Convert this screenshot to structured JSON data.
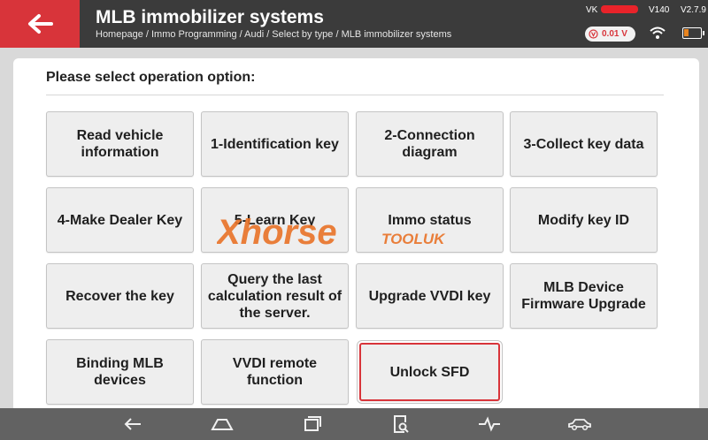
{
  "header": {
    "title": "MLB immobilizer systems",
    "breadcrumb": "Homepage / Immo Programming / Audi / Select by type / MLB immobilizer systems",
    "serial_prefix": "VK",
    "model": "V140",
    "version": "V2.7.9",
    "voltage": "0.01 V"
  },
  "main": {
    "prompt": "Please select operation option:",
    "options": [
      "Read vehicle information",
      "1-Identification key",
      "2-Connection diagram",
      "3-Collect key data",
      "4-Make Dealer Key",
      "5-Learn Key",
      "Immo status",
      "Modify key ID",
      "Recover the key",
      "Query the last calculation result of the server.",
      "Upgrade VVDI key",
      "MLB Device Firmware Upgrade",
      "Binding MLB devices",
      "VVDI remote function",
      "Unlock SFD"
    ],
    "selected_option": "Unlock SFD"
  },
  "watermark": {
    "brand": "Xhorse",
    "site": "TOOLUK"
  },
  "colors": {
    "accent_red": "#d8343a",
    "header_bg": "#3b3b3b",
    "navbar_bg": "#626262",
    "watermark_orange": "#e8742a"
  },
  "navbar_icons": [
    "back-icon",
    "home-icon",
    "recent-apps-icon",
    "screenshot-search-icon",
    "diagnostic-wave-icon",
    "car-icon"
  ]
}
